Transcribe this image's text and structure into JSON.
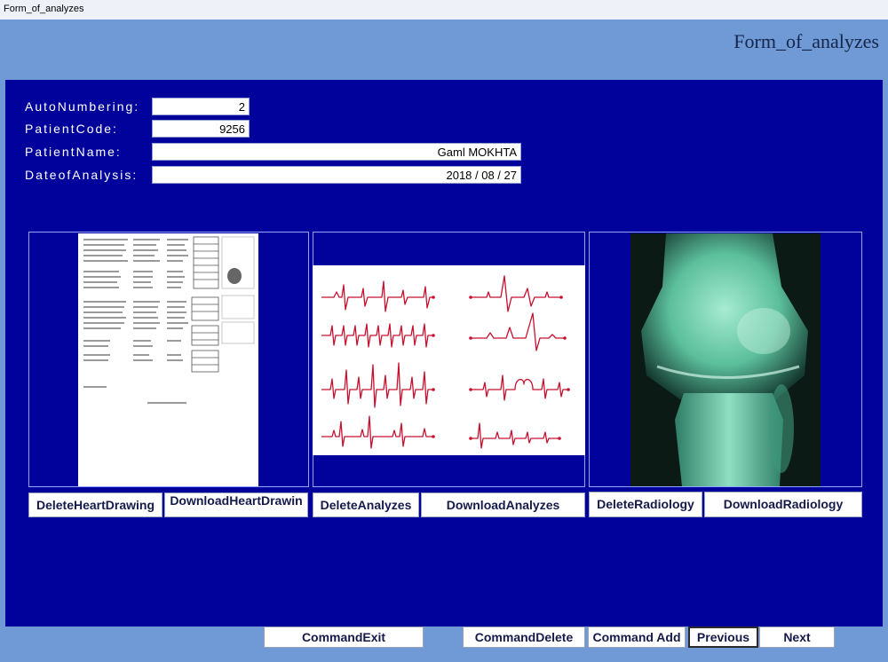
{
  "window": {
    "title": "Form_of_analyzes"
  },
  "header": {
    "form_title": "Form_of_analyzes"
  },
  "fields": [
    {
      "label": "AutoNumbering:",
      "value": "2"
    },
    {
      "label": "PatientCode:",
      "value": "9256"
    },
    {
      "label": "PatientName:",
      "value": "Gaml MOKHTA"
    },
    {
      "label": "DateofAnalysis:",
      "value": "2018 / 08 / 27"
    }
  ],
  "panes": {
    "heart": {
      "delete_label": "DeleteHeartDrawing",
      "download_label": "DownloadHeartDrawin\n_"
    },
    "analyzes": {
      "delete_label": "DeleteAnalyzes",
      "download_label": "DownloadAnalyzes"
    },
    "radiology": {
      "delete_label": "DeleteRadiology",
      "download_label": "DownloadRadiology"
    }
  },
  "footer": {
    "exit_label": "CommandExit",
    "delete_label": "CommandDelete",
    "add_label": "Command Add",
    "previous_label": "Previous",
    "next_label": "Next"
  },
  "colors": {
    "form_background": "#00029b",
    "header_background": "#6f9ad6",
    "ecg_line": "#c8102e",
    "xray_tint": "#4fc9a5"
  }
}
